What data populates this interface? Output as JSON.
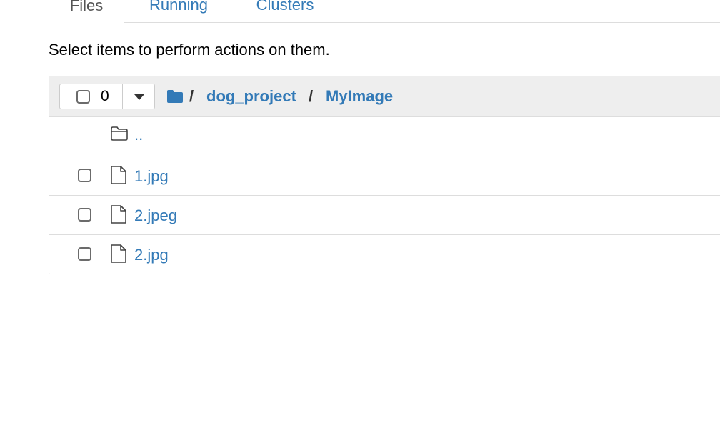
{
  "tabs": [
    {
      "label": "Files",
      "active": true
    },
    {
      "label": "Running",
      "active": false
    },
    {
      "label": "Clusters",
      "active": false
    }
  ],
  "hint": "Select items to perform actions on them.",
  "toolbar": {
    "selected_count": "0"
  },
  "breadcrumb": {
    "separator": "/",
    "items": [
      "dog_project",
      "MyImage"
    ]
  },
  "files": [
    {
      "name": "..",
      "type": "folder",
      "selectable": false
    },
    {
      "name": "1.jpg",
      "type": "file",
      "selectable": true
    },
    {
      "name": "2.jpeg",
      "type": "file",
      "selectable": true
    },
    {
      "name": "2.jpg",
      "type": "file",
      "selectable": true
    }
  ],
  "colors": {
    "link": "#337ab7",
    "header_bg": "#eeeeee",
    "border": "#dddddd"
  },
  "icons": [
    "folder-icon",
    "file-icon",
    "caret-down-icon"
  ]
}
